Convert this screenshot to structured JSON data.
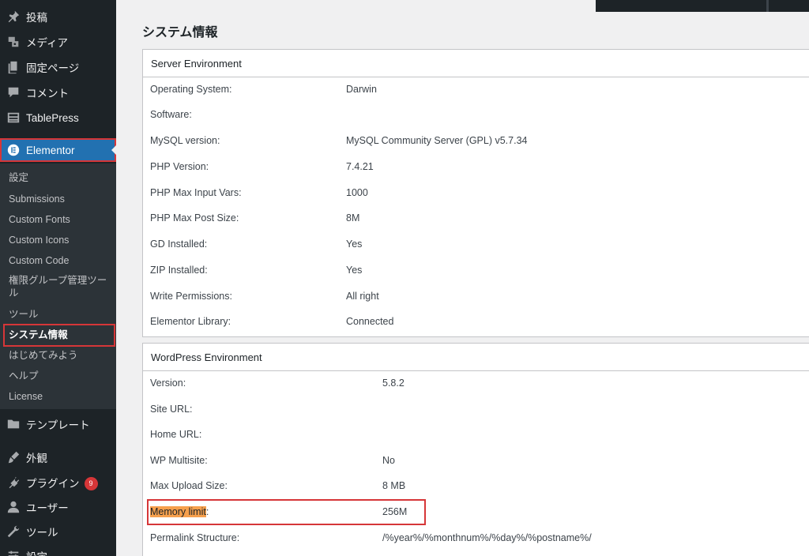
{
  "sidebar": {
    "top_items": [
      {
        "label": "投稿",
        "icon": "pushpin-icon"
      },
      {
        "label": "メディア",
        "icon": "media-icon"
      },
      {
        "label": "固定ページ",
        "icon": "pages-icon"
      },
      {
        "label": "コメント",
        "icon": "comment-icon"
      },
      {
        "label": "TablePress",
        "icon": "table-icon"
      }
    ],
    "active": {
      "label": "Elementor",
      "icon": "elementor-icon"
    },
    "submenu": [
      "設定",
      "Submissions",
      "Custom Fonts",
      "Custom Icons",
      "Custom Code",
      "権限グループ管理ツール",
      "ツール",
      "システム情報",
      "はじめてみよう",
      "ヘルプ",
      "License"
    ],
    "bottom_items": [
      {
        "label": "テンプレート",
        "icon": "folder-icon"
      },
      {
        "label": "外観",
        "icon": "brush-icon"
      },
      {
        "label": "プラグイン",
        "icon": "plugin-icon",
        "badge": "9"
      },
      {
        "label": "ユーザー",
        "icon": "user-icon"
      },
      {
        "label": "ツール",
        "icon": "wrench-icon"
      },
      {
        "label": "設定",
        "icon": "settings-icon"
      }
    ]
  },
  "page": {
    "title": "システム情報"
  },
  "server_env": {
    "title": "Server Environment",
    "rows": [
      {
        "key": "Operating System:",
        "value": "Darwin"
      },
      {
        "key": "Software:",
        "value": ""
      },
      {
        "key": "MySQL version:",
        "value": "MySQL Community Server (GPL) v5.7.34"
      },
      {
        "key": "PHP Version:",
        "value": "7.4.21"
      },
      {
        "key": "PHP Max Input Vars:",
        "value": "1000"
      },
      {
        "key": "PHP Max Post Size:",
        "value": "8M"
      },
      {
        "key": "GD Installed:",
        "value": "Yes"
      },
      {
        "key": "ZIP Installed:",
        "value": "Yes"
      },
      {
        "key": "Write Permissions:",
        "value": "All right"
      },
      {
        "key": "Elementor Library:",
        "value": "Connected"
      }
    ]
  },
  "wp_env": {
    "title": "WordPress Environment",
    "rows": [
      {
        "key": "Version:",
        "value": "5.8.2"
      },
      {
        "key": "Site URL:",
        "value": ""
      },
      {
        "key": "Home URL:",
        "value": ""
      },
      {
        "key": "WP Multisite:",
        "value": "No"
      },
      {
        "key": "Max Upload Size:",
        "value": "8 MB"
      },
      {
        "key": "Memory limit",
        "suffix": ":",
        "value": "256M"
      },
      {
        "key": "Permalink Structure:",
        "value": "/%year%/%monthnum%/%day%/%postname%/"
      }
    ]
  },
  "colors": {
    "sidebar": "#1d2327",
    "submenu": "#2c3338",
    "accent": "#2271b1",
    "highlight_box": "#d63638",
    "text_highlight": "#f6a04d"
  }
}
